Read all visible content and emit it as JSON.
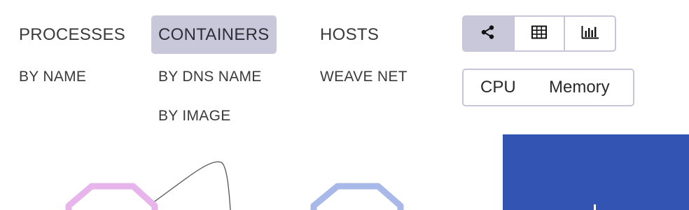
{
  "topology": {
    "processes": {
      "label": "PROCESSES",
      "sub": [
        "BY NAME"
      ]
    },
    "containers": {
      "label": "CONTAINERS",
      "sub": [
        "BY DNS NAME",
        "BY IMAGE"
      ],
      "active": true
    },
    "hosts": {
      "label": "HOSTS",
      "sub": [
        "WEAVE NET"
      ]
    }
  },
  "view_modes": {
    "items": [
      {
        "icon": "share-graph-icon",
        "active": true
      },
      {
        "icon": "table-icon",
        "active": false
      },
      {
        "icon": "bar-chart-icon",
        "active": false
      }
    ]
  },
  "metrics": {
    "cpu": "CPU",
    "memory": "Memory"
  },
  "colors": {
    "active_bg": "#c9c8db",
    "border": "#c7c6d9",
    "node_pink": "#e8b4ec",
    "node_blue": "#a8b8e8",
    "panel_blue": "#3454b4"
  }
}
